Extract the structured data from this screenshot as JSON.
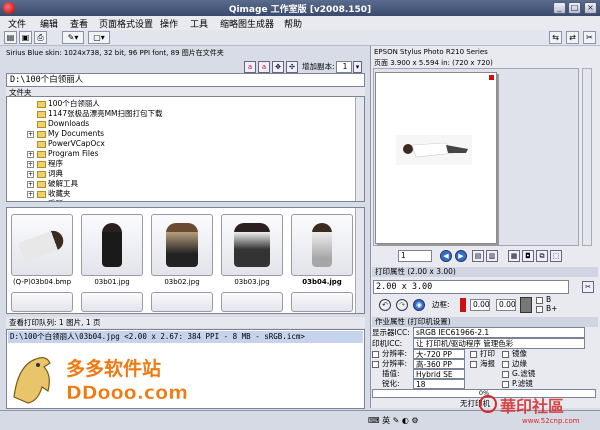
{
  "window": {
    "title": "Qimage 工作室版 [v2008.150]",
    "buttons": [
      "_",
      "□",
      "×"
    ]
  },
  "menu": [
    "文件",
    "编辑",
    "查看",
    "页面格式设置",
    "操作",
    "工具",
    "缩略图生成器",
    "帮助"
  ],
  "info_line": "Sirius Blue skin: 1024x738, 32 bit, 96 PPI font, 89 图片在文件夹",
  "copies": {
    "label": "增加副本:",
    "value": "1"
  },
  "path": "D:\\100个白领丽人",
  "tree": {
    "header": "文件夹",
    "items": [
      "100个白领丽人",
      "1147张极品漂亮MM扫图打包下载",
      "Downloads",
      "My Documents",
      "PowerVCapOcx",
      "Program Files",
      "程序",
      "词典",
      "破解工具",
      "收藏夹",
      "采所"
    ]
  },
  "thumbnails": [
    {
      "label": "(Q-P)03b04.bmp",
      "bold": false
    },
    {
      "label": "03b01.jpg",
      "bold": false
    },
    {
      "label": "03b02.jpg",
      "bold": false
    },
    {
      "label": "03b03.jpg",
      "bold": false
    },
    {
      "label": "03b04.jpg",
      "bold": true
    }
  ],
  "queue": {
    "header": "查看打印队列: 1 图片, 1 页",
    "selected": "D:\\100个白领丽人\\03b04.jpg  <2.00 x 2.67:  384 PPI -   8 MB - sRGB.icm>"
  },
  "printer": {
    "name": "EPSON Stylus Photo R210 Series",
    "page_info": "页面 3.900 x 5.594 in: (720 x 720)",
    "page_select": "1"
  },
  "print_size": {
    "header": "打印属性 (2.00 x 3.00)",
    "value": "2.00 x 3.00",
    "border_label": "边框:",
    "border_values": [
      "0.00",
      "0.00"
    ],
    "opt_b": "B",
    "opt_bplus": "B+"
  },
  "job": {
    "header": "作业属性 (打印机设置)",
    "display_icc_label": "显示器ICC:",
    "display_icc": "sRGB IEC61966-2.1",
    "printer_icc_label": "印机ICC:",
    "printer_icc": "让 打印机/驱动程序 管理色彩",
    "res_label": "分辨率:",
    "res1": "大-720 PP",
    "res2": "高-360 PP",
    "interp_label": "插值:",
    "interp": "Hybrid SE",
    "sharpen_label": "锐化:",
    "sharpen": "18",
    "print_label": "打印",
    "edge_label": "海报",
    "checks": [
      "镜像",
      "边缘",
      "G.滤镜",
      "P.滤镜"
    ]
  },
  "progress": {
    "label": "0%",
    "value": 0
  },
  "status": {
    "text": "无打印机"
  },
  "logo": {
    "text": "多多软件站",
    "url_text": "DDooo.com"
  },
  "watermark": {
    "text": "華印社區",
    "url": "www.52cnp.com"
  },
  "colors": {
    "title": "#3a4a6c",
    "selection": "#c6d3ec",
    "accent_red": "#cc1111",
    "logo_orange": "#f07a10"
  }
}
